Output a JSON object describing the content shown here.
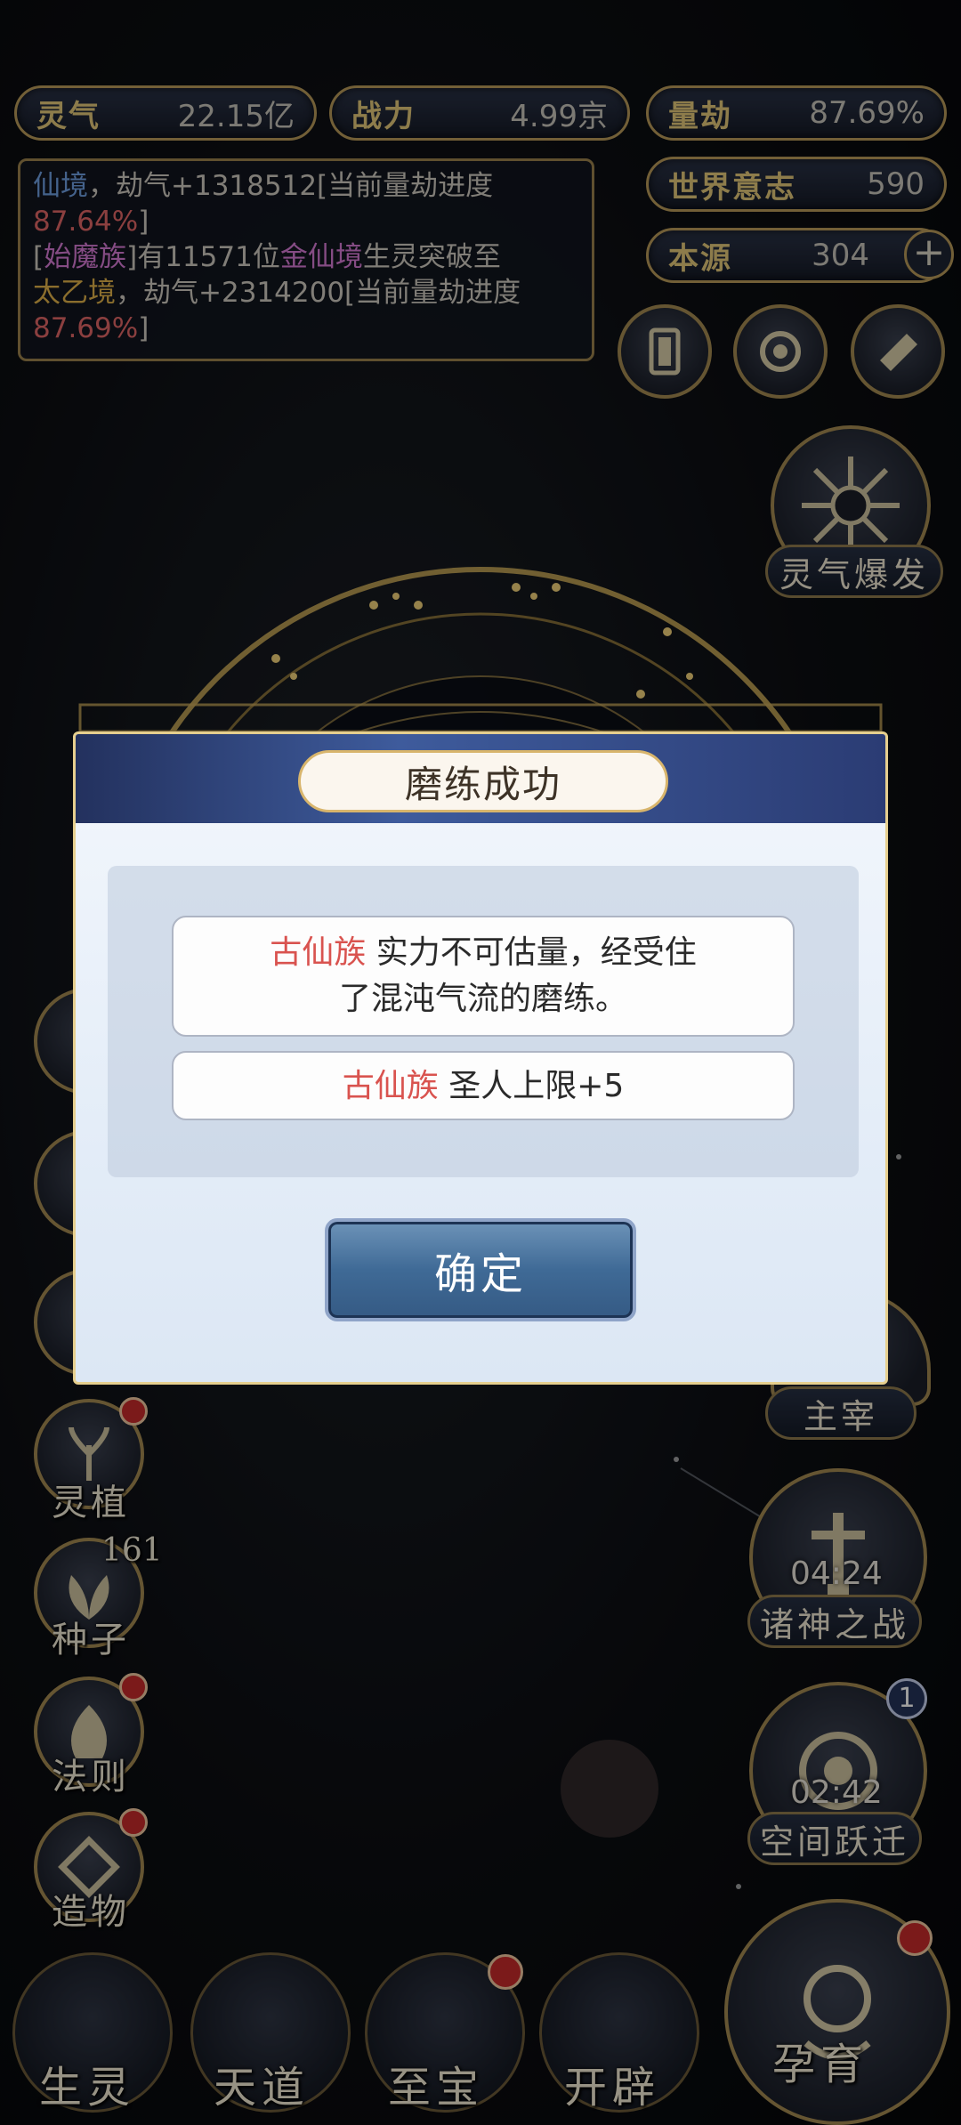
{
  "stats": {
    "lingqi": {
      "label": "灵气",
      "value": "22.15亿"
    },
    "zhanli": {
      "label": "战力",
      "value": "4.99京"
    },
    "liangjie": {
      "label": "量劫",
      "value": "87.69%"
    },
    "world_will": {
      "label": "世界意志",
      "value": "590"
    },
    "benyuan": {
      "label": "本源",
      "value": "304",
      "plus": "+"
    }
  },
  "log": {
    "line1_realm": "仙境",
    "line1_text": "，劫气+1318512[当前量劫进度",
    "line1_pct": "87.64%",
    "line1_end": "]",
    "line2_open": "[",
    "line2_race": "始魔族",
    "line2_mid": "]有11571位",
    "line2_realm": "金仙境",
    "line2_text": "生灵突破至",
    "line3_realm": "太乙境",
    "line3_text": "，劫气+2314200[当前量劫进度",
    "line3_pct": "87.69%",
    "line3_end": "]"
  },
  "right_buttons": {
    "burst_label": "灵气爆发",
    "ruler_label": "主宰",
    "war_timer": "04:24",
    "war_label": "诸神之战",
    "jump_badge": "1",
    "jump_timer": "02:42",
    "jump_label": "空间跃迁",
    "breed_label": "孕育"
  },
  "left_buttons": {
    "plant_label": "灵植",
    "seed_count": "161",
    "seed_label": "种子",
    "law_label": "法则",
    "create_label": "造物"
  },
  "dialog": {
    "title": "磨练成功",
    "msg1_race": "古仙族",
    "msg1_text_a": "实力不可估量，经受住",
    "msg1_text_b": "了混沌气流的磨练。",
    "msg2_race": "古仙族",
    "msg2_text": "圣人上限+5",
    "confirm": "确定"
  },
  "bottom_nav": {
    "creatures": "生灵",
    "heaven": "天道",
    "treasure": "至宝",
    "open": "开辟"
  },
  "colors": {
    "accent_gold": "#e4c97a",
    "race_red": "#d9534f",
    "log_blue": "#6f9ee0",
    "log_pink": "#d77bd6",
    "log_gold": "#e0b24a"
  }
}
